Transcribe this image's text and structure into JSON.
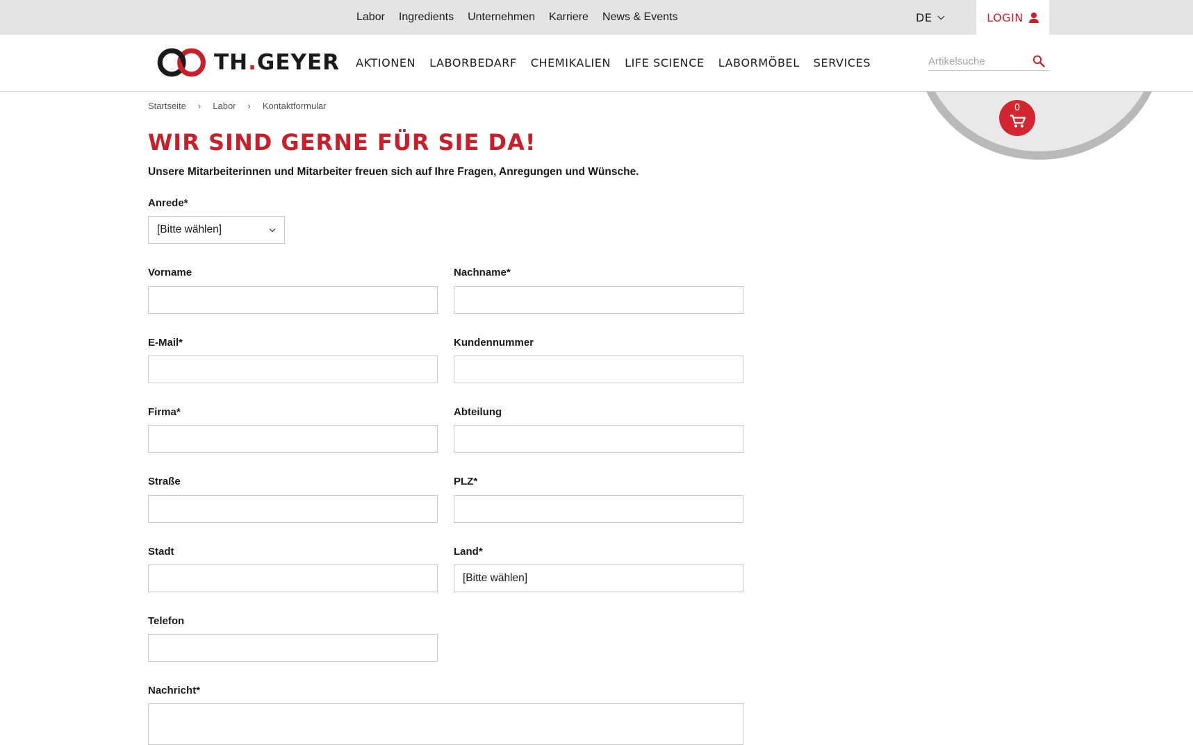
{
  "topbar": {
    "items": [
      "Labor",
      "Ingredients",
      "Unternehmen",
      "Karriere",
      "News & Events"
    ],
    "language": "DE",
    "login_label": "LOGIN"
  },
  "header": {
    "logo_text_main": "TH",
    "logo_text_dot": ".",
    "logo_text_tail": "GEYER",
    "nav": [
      "Aktionen",
      "Laborbedarf",
      "Chemikalien",
      "Life Science",
      "Labormöbel",
      "Services"
    ],
    "search_placeholder": "Artikelsuche"
  },
  "cart": {
    "count": "0"
  },
  "breadcrumb": [
    "Startseite",
    "Labor",
    "Kontaktformular"
  ],
  "page": {
    "title": "WIR SIND GERNE FÜR SIE DA!",
    "intro": "Unsere Mitarbeiterinnen und Mitarbeiter freuen sich auf Ihre Fragen, Anregungen und Wünsche."
  },
  "form": {
    "anrede": {
      "label": "Anrede*",
      "value": "[Bitte wählen]"
    },
    "vorname": {
      "label": "Vorname",
      "value": ""
    },
    "nachname": {
      "label": "Nachname*",
      "value": ""
    },
    "email": {
      "label": "E-Mail*",
      "value": ""
    },
    "kundennummer": {
      "label": "Kundennummer",
      "value": ""
    },
    "firma": {
      "label": "Firma*",
      "value": ""
    },
    "abteilung": {
      "label": "Abteilung",
      "value": ""
    },
    "strasse": {
      "label": "Straße",
      "value": ""
    },
    "plz": {
      "label": "PLZ*",
      "value": ""
    },
    "stadt": {
      "label": "Stadt",
      "value": ""
    },
    "land": {
      "label": "Land*",
      "value": "[Bitte wählen]"
    },
    "telefon": {
      "label": "Telefon",
      "value": ""
    },
    "nachricht": {
      "label": "Nachricht*",
      "value": ""
    }
  },
  "colors": {
    "accent": "#c8202a",
    "topbar_bg": "#e4e4e4"
  }
}
